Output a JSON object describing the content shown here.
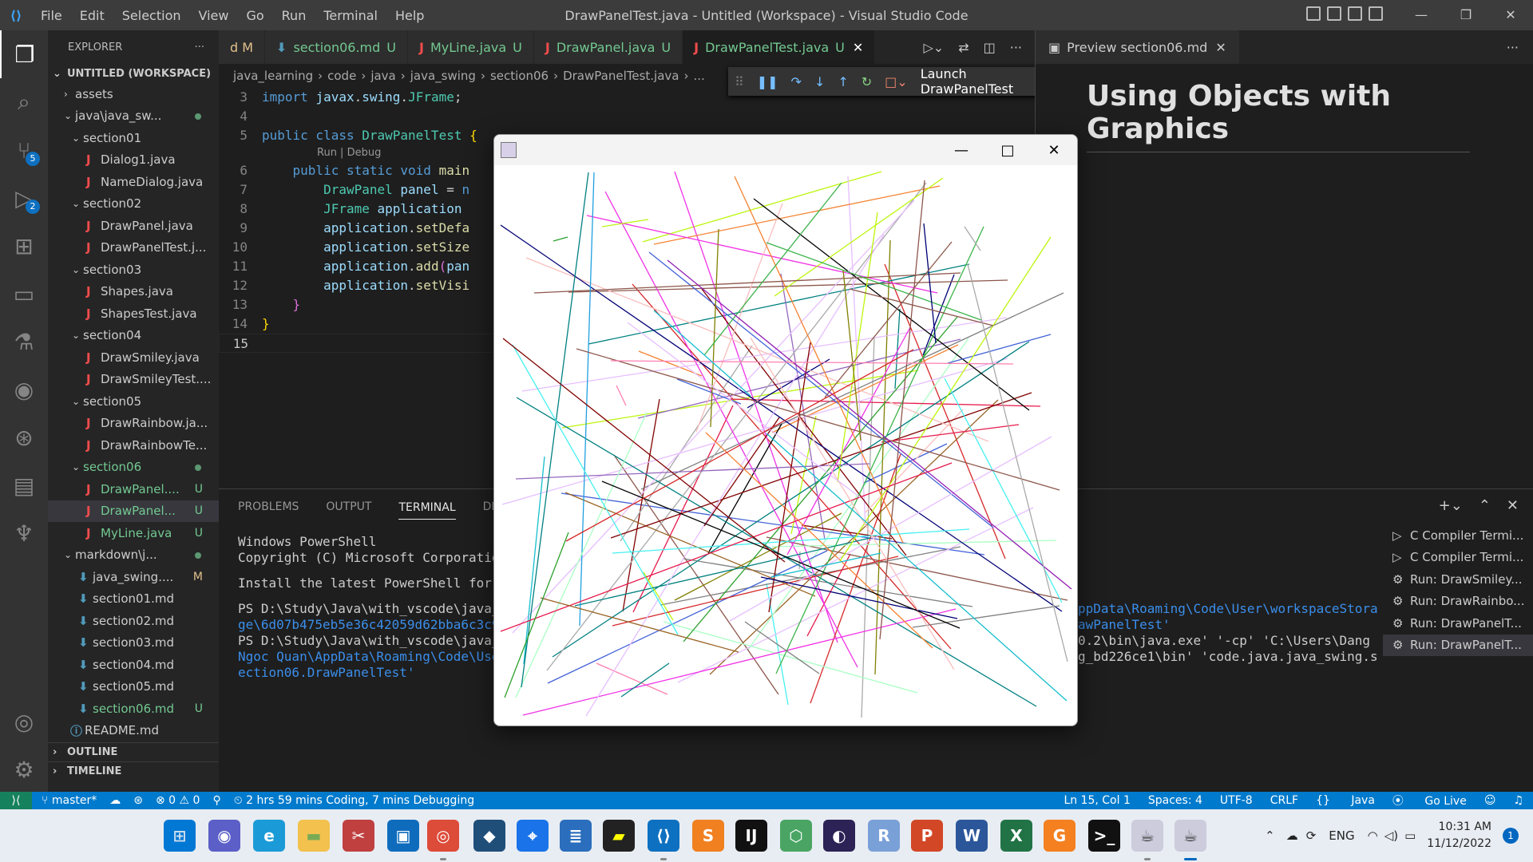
{
  "window_title": "DrawPanelTest.java - Untitled (Workspace) - Visual Studio Code",
  "menu": [
    "File",
    "Edit",
    "Selection",
    "View",
    "Go",
    "Run",
    "Terminal",
    "Help"
  ],
  "activity": {
    "source_control_badge": "5",
    "debug_badge": "2"
  },
  "sidebar": {
    "header": "EXPLORER",
    "workspace": "UNTITLED (WORKSPACE)",
    "items": [
      {
        "label": "assets",
        "kind": "folder",
        "depth": 1,
        "open": false,
        "status": ""
      },
      {
        "label": "java\\java_sw...",
        "kind": "folder",
        "depth": 1,
        "open": true,
        "status": "dot"
      },
      {
        "label": "section01",
        "kind": "folder",
        "depth": 2,
        "open": true,
        "status": ""
      },
      {
        "label": "Dialog1.java",
        "kind": "java",
        "depth": 3,
        "status": ""
      },
      {
        "label": "NameDialog.java",
        "kind": "java",
        "depth": 3,
        "status": ""
      },
      {
        "label": "section02",
        "kind": "folder",
        "depth": 2,
        "open": true,
        "status": ""
      },
      {
        "label": "DrawPanel.java",
        "kind": "java",
        "depth": 3,
        "status": ""
      },
      {
        "label": "DrawPanelTest.j...",
        "kind": "java",
        "depth": 3,
        "status": ""
      },
      {
        "label": "section03",
        "kind": "folder",
        "depth": 2,
        "open": true,
        "status": ""
      },
      {
        "label": "Shapes.java",
        "kind": "java",
        "depth": 3,
        "status": ""
      },
      {
        "label": "ShapesTest.java",
        "kind": "java",
        "depth": 3,
        "status": ""
      },
      {
        "label": "section04",
        "kind": "folder",
        "depth": 2,
        "open": true,
        "status": ""
      },
      {
        "label": "DrawSmiley.java",
        "kind": "java",
        "depth": 3,
        "status": ""
      },
      {
        "label": "DrawSmileyTest....",
        "kind": "java",
        "depth": 3,
        "status": ""
      },
      {
        "label": "section05",
        "kind": "folder",
        "depth": 2,
        "open": true,
        "status": ""
      },
      {
        "label": "DrawRainbow.ja...",
        "kind": "java",
        "depth": 3,
        "status": ""
      },
      {
        "label": "DrawRainbowTe...",
        "kind": "java",
        "depth": 3,
        "status": ""
      },
      {
        "label": "section06",
        "kind": "folder",
        "depth": 2,
        "open": true,
        "status": "dot",
        "green": true
      },
      {
        "label": "DrawPanel....",
        "kind": "java",
        "depth": 3,
        "status": "U",
        "green": true
      },
      {
        "label": "DrawPanel...",
        "kind": "java",
        "depth": 3,
        "status": "U",
        "green": true,
        "selected": true
      },
      {
        "label": "MyLine.java",
        "kind": "java",
        "depth": 3,
        "status": "U",
        "green": true
      },
      {
        "label": "markdown\\j...",
        "kind": "folder",
        "depth": 1,
        "open": true,
        "status": "dot"
      },
      {
        "label": "java_swing....",
        "kind": "md",
        "depth": 2,
        "status": "M"
      },
      {
        "label": "section01.md",
        "kind": "md",
        "depth": 2,
        "status": ""
      },
      {
        "label": "section02.md",
        "kind": "md",
        "depth": 2,
        "status": ""
      },
      {
        "label": "section03.md",
        "kind": "md",
        "depth": 2,
        "status": ""
      },
      {
        "label": "section04.md",
        "kind": "md",
        "depth": 2,
        "status": ""
      },
      {
        "label": "section05.md",
        "kind": "md",
        "depth": 2,
        "status": ""
      },
      {
        "label": "section06.md",
        "kind": "md",
        "depth": 2,
        "status": "U",
        "green": true
      },
      {
        "label": "README.md",
        "kind": "info",
        "depth": 1,
        "status": ""
      }
    ],
    "outline": "OUTLINE",
    "timeline": "TIMELINE"
  },
  "tabs": [
    {
      "label": "d M",
      "icon": "",
      "status": ""
    },
    {
      "label": "section06.md",
      "icon": "md",
      "status": "U"
    },
    {
      "label": "MyLine.java",
      "icon": "java",
      "status": "U"
    },
    {
      "label": "DrawPanel.java",
      "icon": "java",
      "status": "U"
    },
    {
      "label": "DrawPanelTest.java",
      "icon": "java",
      "status": "U",
      "active": true
    }
  ],
  "breadcrumb": [
    "java_learning",
    "code",
    "java",
    "java_swing",
    "section06",
    "DrawPanelTest.java",
    "..."
  ],
  "codelens": "Run | Debug",
  "code_lines": [
    {
      "n": "3",
      "text": "import javax.swing.JFrame;"
    },
    {
      "n": "4",
      "text": ""
    },
    {
      "n": "5",
      "text": "public class DrawPanelTest {"
    },
    {
      "n": "6",
      "text": "    public static void main"
    },
    {
      "n": "7",
      "text": "        DrawPanel panel = n"
    },
    {
      "n": "8",
      "text": "        JFrame application"
    },
    {
      "n": "9",
      "text": "        application.setDefa"
    },
    {
      "n": "10",
      "text": "        application.setSize"
    },
    {
      "n": "11",
      "text": "        application.add(pan"
    },
    {
      "n": "12",
      "text": "        application.setVisi"
    },
    {
      "n": "13",
      "text": "    }"
    },
    {
      "n": "14",
      "text": "}"
    },
    {
      "n": "15",
      "text": ""
    }
  ],
  "debug_toolbar": {
    "launch_config": "Launch DrawPanelTest"
  },
  "preview": {
    "tab": "Preview section06.md",
    "heading": "Using Objects with Graphics"
  },
  "panel": {
    "tabs": [
      "PROBLEMS",
      "OUTPUT",
      "TERMINAL",
      "DEBUG"
    ],
    "active_tab": "TERMINAL",
    "terminal_lines": [
      {
        "text": "Windows PowerShell",
        "link": false
      },
      {
        "text": "Copyright (C) Microsoft Corporation.",
        "link": false
      },
      {
        "text": "",
        "link": false
      },
      {
        "text": "Install the latest PowerShell for ne",
        "link": false
      },
      {
        "text": "",
        "link": false
      },
      {
        "text": "PS D:\\Study\\Java\\with_vscode\\java_le",
        "link": false
      },
      {
        "text": "ge\\6d07b475eb5e36c42059d62bba6c3c97",
        "link": true
      },
      {
        "text": "PS D:\\Study\\Java\\with_vscode\\java_le",
        "link": false
      },
      {
        "text": "Ngoc Quan\\AppData\\Roaming\\Code\\User",
        "link": true
      },
      {
        "text": "ection06.DrawPanelTest'",
        "link": true
      }
    ],
    "terminal_right_lines": [
      "ppData\\Roaming\\Code\\User\\workspaceStora",
      "awPanelTest'",
      "0.2\\bin\\java.exe' '-cp' 'C:\\Users\\Dang",
      "g_bd226ce1\\bin' 'code.java.java_swing.s"
    ],
    "terminal_list": [
      {
        "label": "C Compiler Termi...",
        "icon": "terminal"
      },
      {
        "label": "C Compiler Termi...",
        "icon": "terminal"
      },
      {
        "label": "Run: DrawSmiley...",
        "icon": "debug"
      },
      {
        "label": "Run: DrawRainbo...",
        "icon": "debug"
      },
      {
        "label": "Run: DrawPanelT...",
        "icon": "debug"
      },
      {
        "label": "Run: DrawPanelT...",
        "icon": "debug",
        "selected": true
      }
    ]
  },
  "statusbar": {
    "branch": "master*",
    "errors": "0",
    "warnings": "0",
    "coding_time": "2 hrs 59 mins Coding, 7 mins Debugging",
    "position": "Ln 15, Col 1",
    "spaces": "Spaces: 4",
    "encoding": "UTF-8",
    "eol": "CRLF",
    "language": "Java",
    "live": "Go Live"
  },
  "taskbar": {
    "lang": "ENG",
    "time": "10:31 AM",
    "date": "11/12/2022",
    "notifications": "1"
  },
  "colors": {
    "accent": "#007acc",
    "remote": "#16825d",
    "git_untracked": "#73c991",
    "java_icon": "#f14c4c",
    "md_icon": "#519aba"
  }
}
